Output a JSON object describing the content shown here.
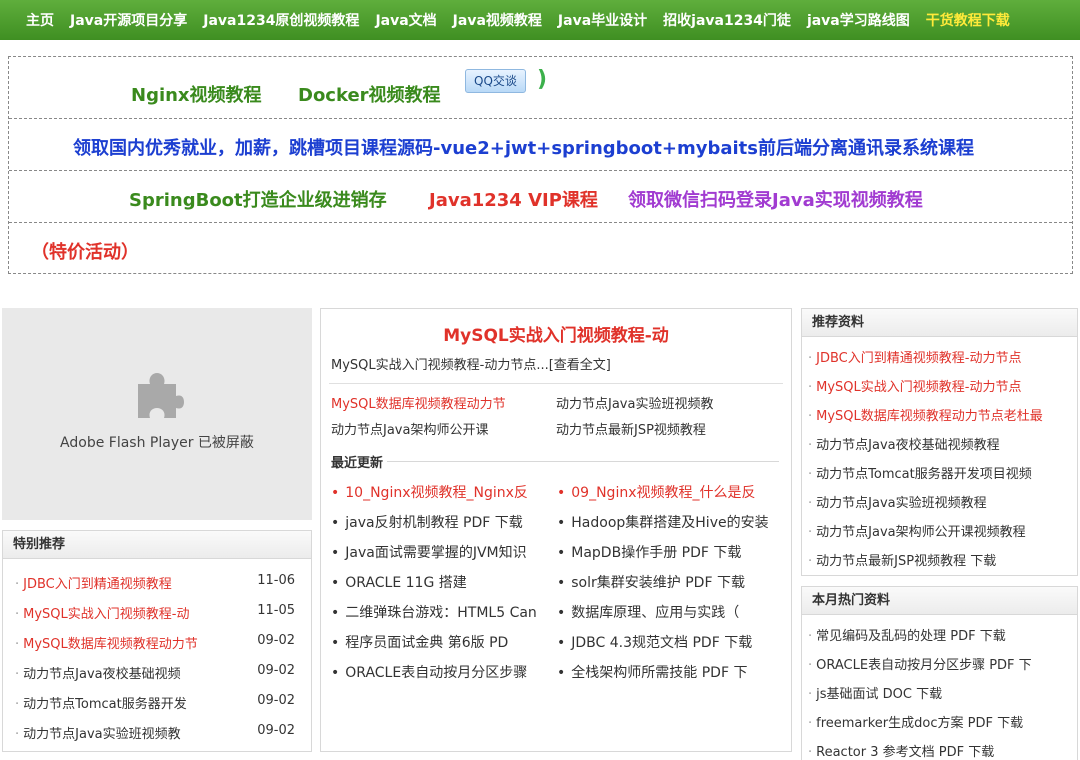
{
  "nav": [
    {
      "label": "主页",
      "highlight": false
    },
    {
      "label": "Java开源项目分享",
      "highlight": false
    },
    {
      "label": "Java1234原创视频教程",
      "highlight": false
    },
    {
      "label": "Java文档",
      "highlight": false
    },
    {
      "label": "Java视频教程",
      "highlight": false
    },
    {
      "label": "Java毕业设计",
      "highlight": false
    },
    {
      "label": "招收java1234门徒",
      "highlight": false
    },
    {
      "label": "java学习路线图",
      "highlight": false
    },
    {
      "label": "干货教程下载",
      "highlight": true
    }
  ],
  "promo": {
    "row1": {
      "nginx": "Nginx视频教程",
      "docker": "Docker视频教程",
      "qq": "QQ交谈",
      "paren": ")"
    },
    "row2": {
      "text": "领取国内优秀就业，加薪，跳槽项目课程源码-vue2+jwt+springboot+mybaits前后端分离通讯录系统课程"
    },
    "row3": {
      "springboot": "SpringBoot打造企业级进销存",
      "vip": "Java1234 VIP课程",
      "wechat": "领取微信扫码登录Java实现视频教程"
    },
    "row4": {
      "special": "（特价活动）"
    }
  },
  "flash": {
    "text": "Adobe Flash Player 已被屏蔽"
  },
  "special": {
    "title": "特别推荐",
    "items": [
      {
        "label": "JDBC入门到精通视频教程",
        "date": "11-06",
        "red": true
      },
      {
        "label": "MySQL实战入门视频教程-动",
        "date": "11-05",
        "red": true
      },
      {
        "label": "MySQL数据库视频教程动力节",
        "date": "09-02",
        "red": true
      },
      {
        "label": "动力节点Java夜校基础视频",
        "date": "09-02",
        "red": false
      },
      {
        "label": "动力节点Tomcat服务器开发",
        "date": "09-02",
        "red": false
      },
      {
        "label": "动力节点Java实验班视频教",
        "date": "09-02",
        "red": false
      }
    ]
  },
  "middle": {
    "title": "MySQL实战入门视频教程-动",
    "desc": "MySQL实战入门视频教程-动力节点...",
    "more": "[查看全文]",
    "links": [
      {
        "label": "MySQL数据库视频教程动力节",
        "red": true
      },
      {
        "label": "动力节点Java实验班视频教",
        "red": false
      },
      {
        "label": "动力节点Java架构师公开课",
        "red": false
      },
      {
        "label": "动力节点最新JSP视频教程",
        "red": false
      }
    ],
    "recent_title": "最近更新",
    "recent": [
      {
        "label": "10_Nginx视频教程_Nginx反",
        "red": true
      },
      {
        "label": "09_Nginx视频教程_什么是反",
        "red": true
      },
      {
        "label": "java反射机制教程 PDF 下载",
        "red": false
      },
      {
        "label": "Hadoop集群搭建及Hive的安装",
        "red": false
      },
      {
        "label": "Java面试需要掌握的JVM知识",
        "red": false
      },
      {
        "label": "MapDB操作手册 PDF 下载",
        "red": false
      },
      {
        "label": "ORACLE 11G 搭建",
        "red": false
      },
      {
        "label": "solr集群安装维护 PDF 下载",
        "red": false
      },
      {
        "label": "二维弹珠台游戏：HTML5 Can",
        "red": false
      },
      {
        "label": "数据库原理、应用与实践（",
        "red": false
      },
      {
        "label": "程序员面试金典 第6版 PD",
        "red": false
      },
      {
        "label": "JDBC 4.3规范文档 PDF 下载",
        "red": false
      },
      {
        "label": "ORACLE表自动按月分区步骤",
        "red": false
      },
      {
        "label": "全栈架构师所需技能 PDF 下",
        "red": false
      }
    ]
  },
  "recommend": {
    "title": "推荐资料",
    "items": [
      {
        "label": "JDBC入门到精通视频教程-动力节点",
        "red": true
      },
      {
        "label": "MySQL实战入门视频教程-动力节点",
        "red": true
      },
      {
        "label": "MySQL数据库视频教程动力节点老杜最",
        "red": true
      },
      {
        "label": "动力节点Java夜校基础视频教程",
        "red": false
      },
      {
        "label": "动力节点Tomcat服务器开发项目视频",
        "red": false
      },
      {
        "label": "动力节点Java实验班视频教程",
        "red": false
      },
      {
        "label": "动力节点Java架构师公开课视频教程",
        "red": false
      },
      {
        "label": "动力节点最新JSP视频教程 下载",
        "red": false
      }
    ]
  },
  "hot": {
    "title": "本月热门资料",
    "items": [
      {
        "label": "常见编码及乱码的处理 PDF 下载",
        "red": false
      },
      {
        "label": "ORACLE表自动按月分区步骤 PDF 下",
        "red": false
      },
      {
        "label": "js基础面试 DOC 下载",
        "red": false
      },
      {
        "label": "freemarker生成doc方案 PDF 下载",
        "red": false
      },
      {
        "label": "Reactor 3 参考文档 PDF 下载",
        "red": false
      }
    ]
  },
  "colors": {
    "nav_green": "#3f8f22",
    "link_red": "#e0322a",
    "promo_blue": "#1c3fd1",
    "promo_green": "#3a8a1d",
    "promo_purple": "#a13bd1",
    "nav_highlight": "#ffea3a"
  }
}
